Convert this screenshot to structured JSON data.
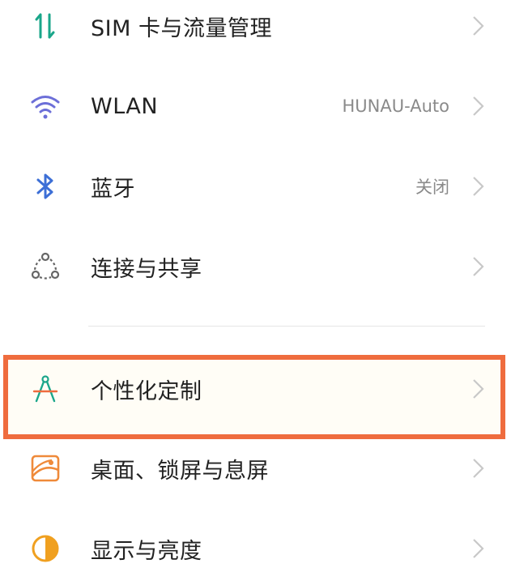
{
  "settings": {
    "items": [
      {
        "label": "SIM 卡与流量管理",
        "value": "",
        "icon": "sim-data-icon"
      },
      {
        "label": "WLAN",
        "value": "HUNAU-Auto",
        "icon": "wifi-icon"
      },
      {
        "label": "蓝牙",
        "value": "关闭",
        "icon": "bluetooth-icon"
      },
      {
        "label": "连接与共享",
        "value": "",
        "icon": "connection-share-icon"
      },
      {
        "label": "个性化定制",
        "value": "",
        "icon": "personalization-compass-icon"
      },
      {
        "label": "桌面、锁屏与息屏",
        "value": "",
        "icon": "wallpaper-icon"
      },
      {
        "label": "显示与亮度",
        "value": "",
        "icon": "display-brightness-icon"
      }
    ]
  },
  "colors": {
    "highlight_border": "#ef6c3e",
    "sim_icon": "#1aa68a",
    "wifi_icon": "#6c6fd8",
    "bluetooth_icon": "#3d6fd6",
    "share_icon": "#666666",
    "compass_icon": "#1aa68a",
    "wallpaper_icon": "#ef8a3a",
    "display_icon": "#f0a020"
  }
}
